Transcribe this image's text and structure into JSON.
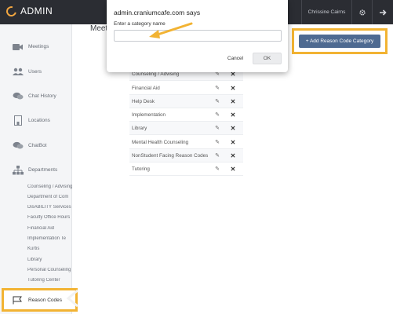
{
  "header": {
    "app_title": "ADMIN",
    "user_name": "Chrissine Cairns",
    "settings_icon": "gear-icon",
    "logout_icon": "arrow-right-icon"
  },
  "sidebar": {
    "items": [
      {
        "label": "Meetings",
        "icon": "video-camera-icon"
      },
      {
        "label": "Users",
        "icon": "users-icon"
      },
      {
        "label": "Chat History",
        "icon": "chat-bubbles-icon"
      },
      {
        "label": "Locations",
        "icon": "building-icon"
      },
      {
        "label": "ChatBot",
        "icon": "chat-bubbles-icon"
      },
      {
        "label": "Departments",
        "icon": "org-chart-icon"
      }
    ],
    "departments": [
      "Counseling / Advising",
      "Department of Com",
      "DisABILITY Services",
      "Faculty Office Hours",
      "Financial Aid",
      "Implementation Te",
      "Kurtis",
      "Library",
      "Personal Counseling",
      "Tutoring Center"
    ],
    "active_item": {
      "label": "Reason Codes",
      "icon": "flag-icon"
    }
  },
  "main": {
    "page_title": "Meeti",
    "add_button_label": "+ Add Reason Code Category",
    "categories": [
      "Counseling / Advising",
      "Financial Aid",
      "Help Desk",
      "Implementation",
      "Library",
      "Mental Health Counseling",
      "NonStudent Facing Reason Codes",
      "Tutoring"
    ]
  },
  "dialog": {
    "title": "admin.craniumcafe.com says",
    "prompt": "Enter a category name",
    "input_value": "",
    "cancel_label": "Cancel",
    "ok_label": "OK"
  },
  "colors": {
    "topbar": "#2b2d33",
    "accent_orange": "#f2a640",
    "highlight_border": "#f2b333",
    "primary_button": "#4e6a91",
    "sidebar_bg": "#f4f5f7"
  }
}
